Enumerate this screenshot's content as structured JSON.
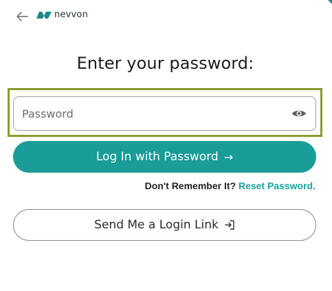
{
  "header": {
    "back_icon": "arrow-left-icon",
    "logo_text": "nevvon",
    "brand_color": "#1a9c98"
  },
  "main": {
    "heading": "Enter your password:",
    "password_field": {
      "placeholder": "Password",
      "value": "",
      "toggle_icon": "eye-icon"
    },
    "login_button": {
      "label": "Log In with Password",
      "icon": "→"
    },
    "remember": {
      "prompt": "Don't Remember It?",
      "link": "Reset Password."
    },
    "login_link_button": {
      "label": "Send Me a Login Link",
      "icon": "login-icon"
    }
  },
  "colors": {
    "accent": "#1a9c98",
    "link": "#17a1a0",
    "focus_outline": "#8a9a2a"
  }
}
